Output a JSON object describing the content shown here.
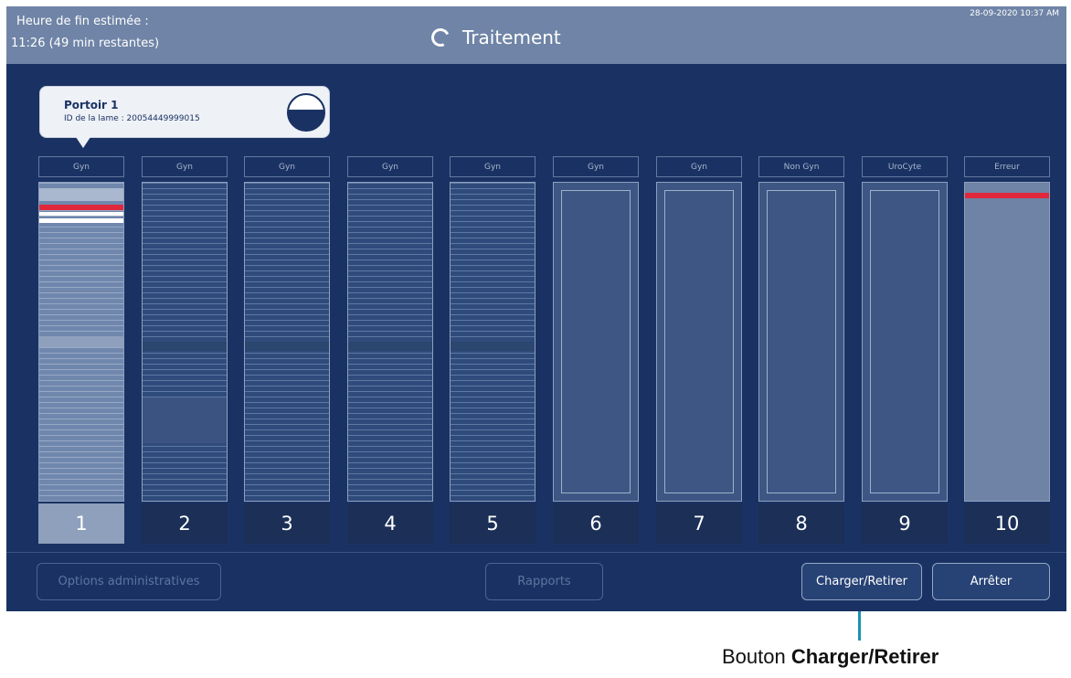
{
  "header": {
    "eta_label": "Heure de fin estimée :",
    "eta_value": "11:26 (49 min restantes)",
    "title": "Traitement",
    "datetime": "28-09-2020 10:37 AM"
  },
  "tooltip": {
    "title": "Portoir 1",
    "slide_id": "ID de la lame : 20054449999015"
  },
  "racks": [
    {
      "number": "1",
      "type": "Gyn",
      "state": "active"
    },
    {
      "number": "2",
      "type": "Gyn",
      "state": "slots"
    },
    {
      "number": "3",
      "type": "Gyn",
      "state": "slots"
    },
    {
      "number": "4",
      "type": "Gyn",
      "state": "slots"
    },
    {
      "number": "5",
      "type": "Gyn",
      "state": "slots"
    },
    {
      "number": "6",
      "type": "Gyn",
      "state": "empty"
    },
    {
      "number": "7",
      "type": "Gyn",
      "state": "empty"
    },
    {
      "number": "8",
      "type": "Non Gyn",
      "state": "empty"
    },
    {
      "number": "9",
      "type": "UroCyte",
      "state": "empty"
    },
    {
      "number": "10",
      "type": "Erreur",
      "state": "error"
    }
  ],
  "footer": {
    "admin_label": "Options administratives",
    "reports_label": "Rapports",
    "load_label": "Charger/Retirer",
    "stop_label": "Arrêter"
  },
  "annotation": {
    "prefix": "Bouton",
    "bold": "Charger/Retirer"
  },
  "colors": {
    "background": "#1a3263",
    "header": "#6f84a6",
    "error_red": "#e0283c",
    "callout": "#1794b1"
  }
}
